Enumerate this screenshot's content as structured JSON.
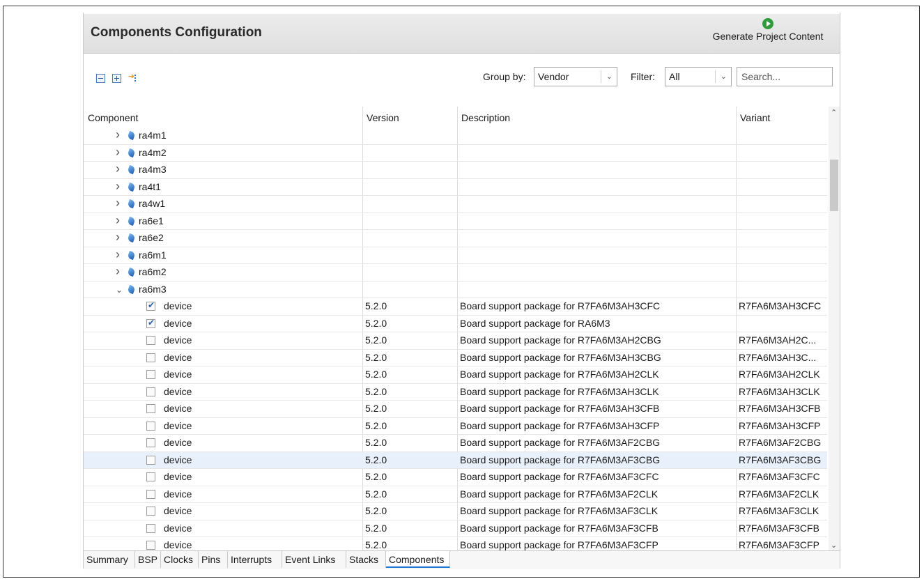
{
  "header": {
    "title": "Components Configuration",
    "generate_label": "Generate Project Content"
  },
  "toolbar": {
    "group_by_label": "Group by:",
    "group_by_value": "Vendor",
    "filter_label": "Filter:",
    "filter_value": "All",
    "search_placeholder": "Search..."
  },
  "table": {
    "columns": [
      "Component",
      "Version",
      "Description",
      "Variant"
    ],
    "rows": [
      {
        "kind": "group",
        "name": "ra4m1",
        "expanded": false
      },
      {
        "kind": "group",
        "name": "ra4m2",
        "expanded": false
      },
      {
        "kind": "group",
        "name": "ra4m3",
        "expanded": false
      },
      {
        "kind": "group",
        "name": "ra4t1",
        "expanded": false
      },
      {
        "kind": "group",
        "name": "ra4w1",
        "expanded": false
      },
      {
        "kind": "group",
        "name": "ra6e1",
        "expanded": false
      },
      {
        "kind": "group",
        "name": "ra6e2",
        "expanded": false
      },
      {
        "kind": "group",
        "name": "ra6m1",
        "expanded": false
      },
      {
        "kind": "group",
        "name": "ra6m2",
        "expanded": false
      },
      {
        "kind": "group",
        "name": "ra6m3",
        "expanded": true
      },
      {
        "kind": "item",
        "name": "device",
        "checked": true,
        "version": "5.2.0",
        "description": "Board support package for R7FA6M3AH3CFC",
        "variant": "R7FA6M3AH3CFC"
      },
      {
        "kind": "item",
        "name": "device",
        "checked": true,
        "version": "5.2.0",
        "description": "Board support package for RA6M3",
        "variant": ""
      },
      {
        "kind": "item",
        "name": "device",
        "checked": false,
        "version": "5.2.0",
        "description": "Board support package for R7FA6M3AH2CBG",
        "variant": "R7FA6M3AH2C..."
      },
      {
        "kind": "item",
        "name": "device",
        "checked": false,
        "version": "5.2.0",
        "description": "Board support package for R7FA6M3AH3CBG",
        "variant": "R7FA6M3AH3C..."
      },
      {
        "kind": "item",
        "name": "device",
        "checked": false,
        "version": "5.2.0",
        "description": "Board support package for R7FA6M3AH2CLK",
        "variant": "R7FA6M3AH2CLK"
      },
      {
        "kind": "item",
        "name": "device",
        "checked": false,
        "version": "5.2.0",
        "description": "Board support package for R7FA6M3AH3CLK",
        "variant": "R7FA6M3AH3CLK"
      },
      {
        "kind": "item",
        "name": "device",
        "checked": false,
        "version": "5.2.0",
        "description": "Board support package for R7FA6M3AH3CFB",
        "variant": "R7FA6M3AH3CFB"
      },
      {
        "kind": "item",
        "name": "device",
        "checked": false,
        "version": "5.2.0",
        "description": "Board support package for R7FA6M3AH3CFP",
        "variant": "R7FA6M3AH3CFP"
      },
      {
        "kind": "item",
        "name": "device",
        "checked": false,
        "version": "5.2.0",
        "description": "Board support package for R7FA6M3AF2CBG",
        "variant": "R7FA6M3AF2CBG"
      },
      {
        "kind": "item",
        "name": "device",
        "checked": false,
        "selected": true,
        "version": "5.2.0",
        "description": "Board support package for R7FA6M3AF3CBG",
        "variant": "R7FA6M3AF3CBG"
      },
      {
        "kind": "item",
        "name": "device",
        "checked": false,
        "version": "5.2.0",
        "description": "Board support package for R7FA6M3AF3CFC",
        "variant": "R7FA6M3AF3CFC"
      },
      {
        "kind": "item",
        "name": "device",
        "checked": false,
        "version": "5.2.0",
        "description": "Board support package for R7FA6M3AF2CLK",
        "variant": "R7FA6M3AF2CLK"
      },
      {
        "kind": "item",
        "name": "device",
        "checked": false,
        "version": "5.2.0",
        "description": "Board support package for R7FA6M3AF3CLK",
        "variant": "R7FA6M3AF3CLK"
      },
      {
        "kind": "item",
        "name": "device",
        "checked": false,
        "version": "5.2.0",
        "description": "Board support package for R7FA6M3AF3CFB",
        "variant": "R7FA6M3AF3CFB"
      },
      {
        "kind": "item",
        "name": "device",
        "checked": false,
        "version": "5.2.0",
        "description": "Board support package for R7FA6M3AF3CFP",
        "variant": "R7FA6M3AF3CFP"
      }
    ]
  },
  "tabs": [
    "Summary",
    "BSP",
    "Clocks",
    "Pins",
    "Interrupts",
    "Event Links",
    "Stacks",
    "Components"
  ],
  "active_tab": "Components",
  "icons": {
    "generate": "play-circle-icon",
    "collapse_all": "collapse-all-icon",
    "expand_all": "expand-all-icon",
    "filter_tree": "tree-filter-icon",
    "component": "chip-icon"
  },
  "colors": {
    "accent": "#1e78d4",
    "generate_icon": "#2e9c3c",
    "selected_row": "#e8f1fb",
    "header_bg": "#e4e4e4"
  }
}
